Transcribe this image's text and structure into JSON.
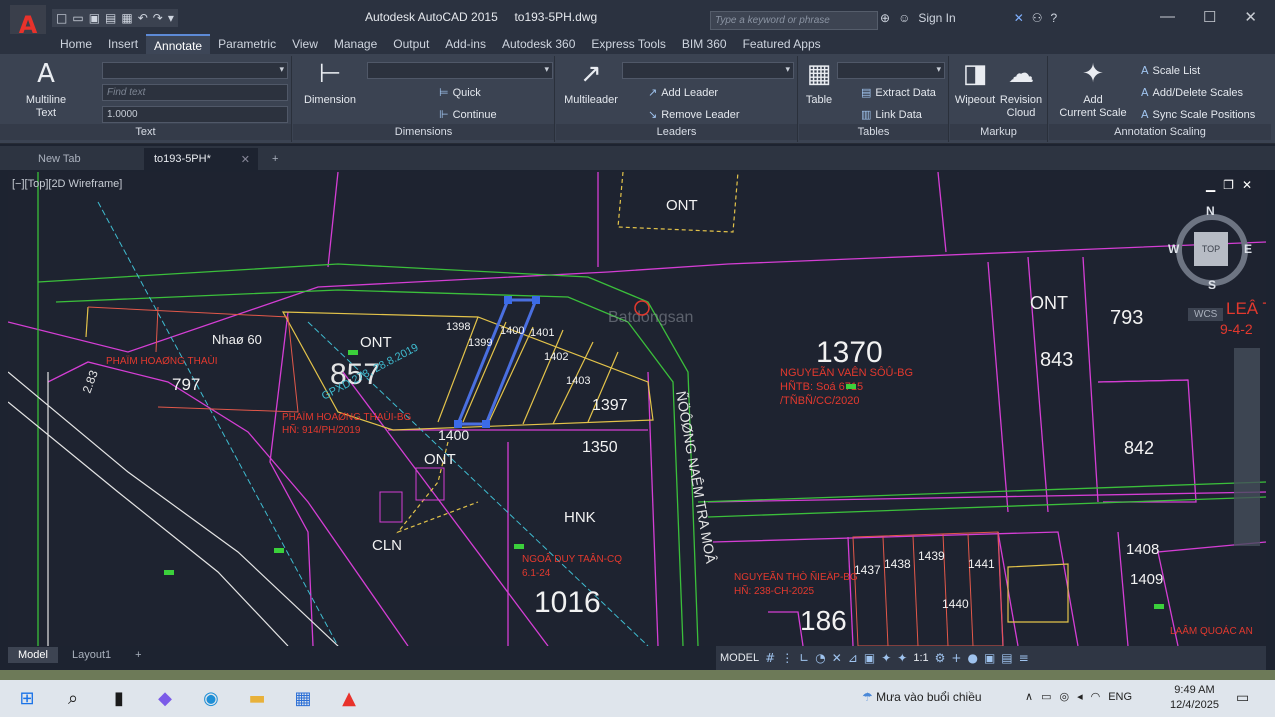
{
  "app": {
    "title": "Autodesk AutoCAD 2015",
    "file": "to193-5PH.dwg",
    "search_placeholder": "Type a keyword or phrase",
    "sign_in": "Sign In",
    "logo_letter": "A"
  },
  "menu": [
    "Home",
    "Insert",
    "Annotate",
    "Parametric",
    "View",
    "Manage",
    "Output",
    "Add-ins",
    "Autodesk 360",
    "Express Tools",
    "BIM 360",
    "Featured Apps"
  ],
  "menu_active": "Annotate",
  "ribbon": {
    "text": {
      "multiline": "Multiline",
      "text": "Text",
      "find_placeholder": "Find text",
      "scale": "1.0000",
      "label": "Text"
    },
    "dimensions": {
      "dimension": "Dimension",
      "quick": "Quick",
      "continue": "Continue",
      "label": "Dimensions"
    },
    "leaders": {
      "multileader": "Multileader",
      "add": "Add Leader",
      "remove": "Remove Leader",
      "label": "Leaders"
    },
    "tables": {
      "table": "Table",
      "extract": "Extract Data",
      "link": "Link Data",
      "label": "Tables"
    },
    "markup": {
      "wipeout": "Wipeout",
      "revision": "Revision",
      "cloud": "Cloud",
      "label": "Markup"
    },
    "scaling": {
      "add": "Add",
      "current": "Current Scale",
      "list": "Scale List",
      "adddelete": "Add/Delete Scales",
      "sync": "Sync Scale Positions",
      "label": "Annotation Scaling"
    }
  },
  "file_tabs": {
    "new": "New Tab",
    "current": "to193-5PH*"
  },
  "viewport": {
    "label": "[−][Top][2D Wireframe]",
    "top": "TOP",
    "n": "N",
    "s": "S",
    "e": "E",
    "w": "W",
    "wcs": "WCS"
  },
  "drawing": {
    "labels": [
      "ONT",
      "ONT",
      "ONT",
      "ONT",
      "CLN",
      "HNK",
      "Nhaø 60"
    ],
    "numbers": {
      "n857": "857",
      "n797": "797",
      "n1370": "1370",
      "n1016": "1016",
      "n1400": "1400",
      "n1397": "1397",
      "n1350": "1350",
      "n843": "843",
      "n793": "793",
      "n842": "842",
      "n1408": "1408",
      "n1409": "1409",
      "n186": "186",
      "n1437": "1437",
      "n1438": "1438",
      "n1439": "1439",
      "n1441": "1441",
      "n1440": "1440",
      "n1398": "1398",
      "n1399": "1399",
      "n1401": "1401",
      "n1402": "1402",
      "n1403": "1403",
      "n1400b": "1400"
    },
    "owners": {
      "a": "PHAÏM HOAØNG THAÙI",
      "b": "PHAÏM HOAØNG THAÙI-BG",
      "b2": "HÑ: 914/PH/2019",
      "c": "NGUYEÃN VAÊN SÔÛ-BG",
      "c2": "HÑTB: Soá 6715",
      "c3": "/TÑBÑ/CC/2020",
      "d": "NGOÂ DUY TAÂN-CQ",
      "d2": "6.1-24",
      "e": "NGUYEÃN THÒ ÑIEÄP-BG",
      "e2": "HÑ: 238-CH-2025",
      "f": "LAÂM QUOÁC AN",
      "g": "LEÂ T",
      "g2": "9-4-2",
      "road": "ÑÖÔØNG NAÊM TRA MOÂ",
      "diag": "GPXD 278, 28.8.2019"
    },
    "scale_283": "2.83"
  },
  "layout_tabs": [
    "Model",
    "Layout1"
  ],
  "status": {
    "model": "MODEL",
    "scale": "1:1"
  },
  "taskbar": {
    "weather": "Mưa vào buổi chiều",
    "lang": "ENG",
    "time": "9:49 AM",
    "date": "12/4/2025"
  },
  "watermark": "Batdongsan"
}
